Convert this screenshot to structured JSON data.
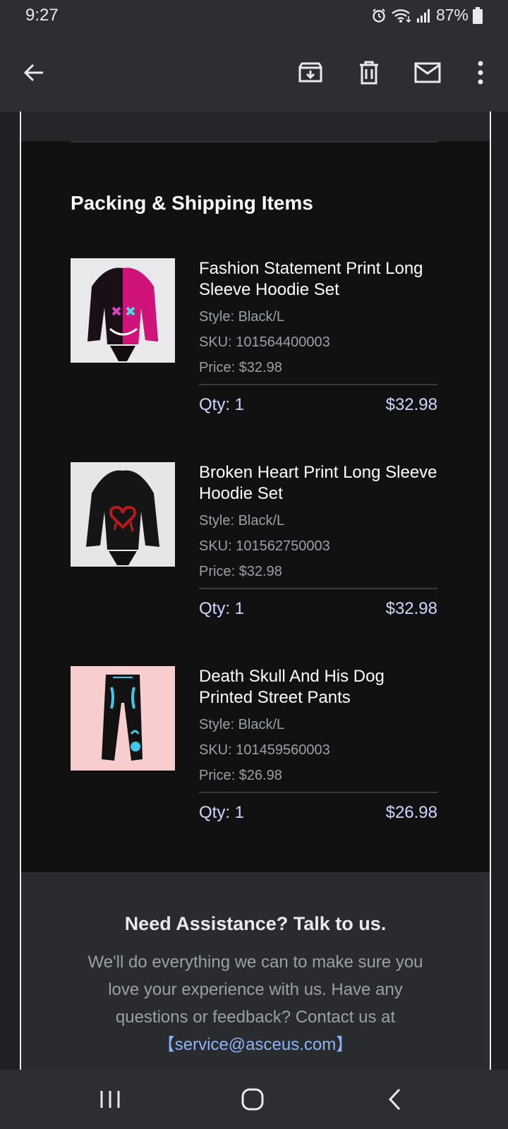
{
  "status_bar": {
    "time": "9:27",
    "battery": "87%",
    "icons": [
      "alarm-icon",
      "wifi-icon",
      "signal-icon",
      "battery-icon"
    ]
  },
  "app_bar": {
    "icons": [
      "back-arrow-icon",
      "archive-icon",
      "delete-icon",
      "mail-icon",
      "more-vert-icon"
    ]
  },
  "email": {
    "section_title": "Packing & Shipping Items",
    "items": [
      {
        "name": "Fashion Statement Print Long Sleeve Hoodie Set",
        "style": "Style: Black/L",
        "sku": "SKU: 101564400003",
        "price": "Price: $32.98",
        "qty": "Qty: 1",
        "total": "$32.98",
        "image": "black-pink-hoodie-set-image"
      },
      {
        "name": "Broken Heart Print Long Sleeve Hoodie Set",
        "style": "Style: Black/L",
        "sku": "SKU: 101562750003",
        "price": "Price: $32.98",
        "qty": "Qty: 1",
        "total": "$32.98",
        "image": "black-heart-hoodie-set-image"
      },
      {
        "name": "Death Skull And His Dog Printed Street Pants",
        "style": "Style: Black/L",
        "sku": "SKU: 101459560003",
        "price": "Price: $26.98",
        "qty": "Qty: 1",
        "total": "$26.98",
        "image": "skull-street-pants-image"
      }
    ],
    "assistance": {
      "title": "Need Assistance? Talk to us.",
      "text": "We'll do everything we can to make sure you love your experience with us. Have any questions or feedback? Contact us at",
      "email_link": "【service@asceus.com】"
    }
  },
  "nav_bar": {
    "icons": [
      "recent-apps-icon",
      "home-icon",
      "back-icon"
    ]
  },
  "colors": {
    "background": "#202124",
    "items_background": "#111112",
    "qty_text": "#cfd6ff",
    "link": "#8ab4f8"
  }
}
